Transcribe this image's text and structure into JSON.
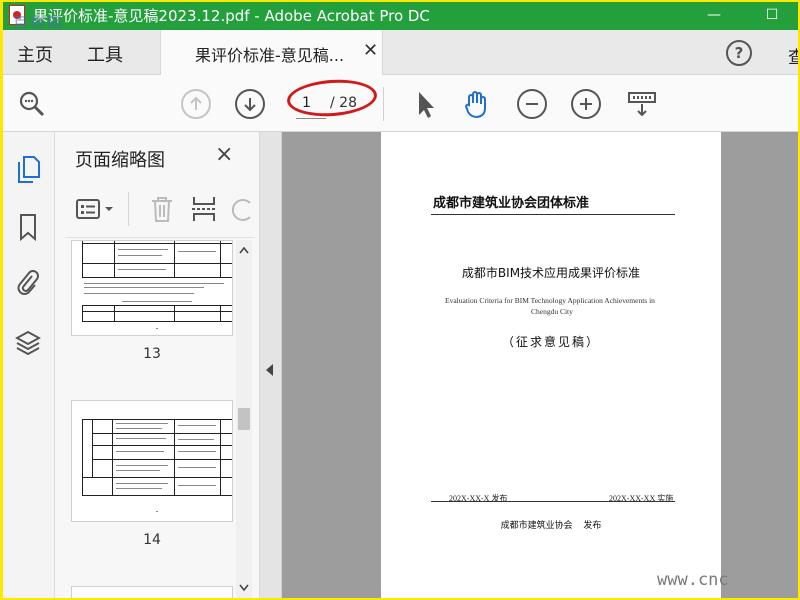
{
  "window": {
    "title": "果评价标准-意见稿2023.12.pdf - Adobe Acrobat Pro DC",
    "watermark_top": "百称网",
    "watermark_bottom": "www.cnc"
  },
  "tabs": {
    "home": "主页",
    "tools": "工具",
    "document": "果评价标准-意见稿...",
    "right_cut": "查"
  },
  "toolbar": {
    "current_page": "1",
    "total_pages": "/ 28",
    "help_icon": "?"
  },
  "thumbnails": {
    "title": "页面缩略图",
    "close": "×",
    "pages": [
      {
        "label": "13"
      },
      {
        "label": "14"
      }
    ]
  },
  "page_content": {
    "org_standard": "成都市建筑业协会团体标准",
    "title": "成都市BIM技术应用成果评价标准",
    "english_line1": "Evaluation Criteria for BIM Technology Application Achievements in",
    "english_line2": "Chengdu City",
    "draft_label": "（征求意见稿）",
    "issued": "202X-XX-X 发布",
    "implemented": "202X-XX-XX 实施",
    "publisher": "成都市建筑业协会 发布"
  },
  "colors": {
    "titlebar": "#239f3c",
    "outer_frame": "#ffe800",
    "annotation_oval": "#d21a1a",
    "hand_tool": "#1f6fd1"
  }
}
